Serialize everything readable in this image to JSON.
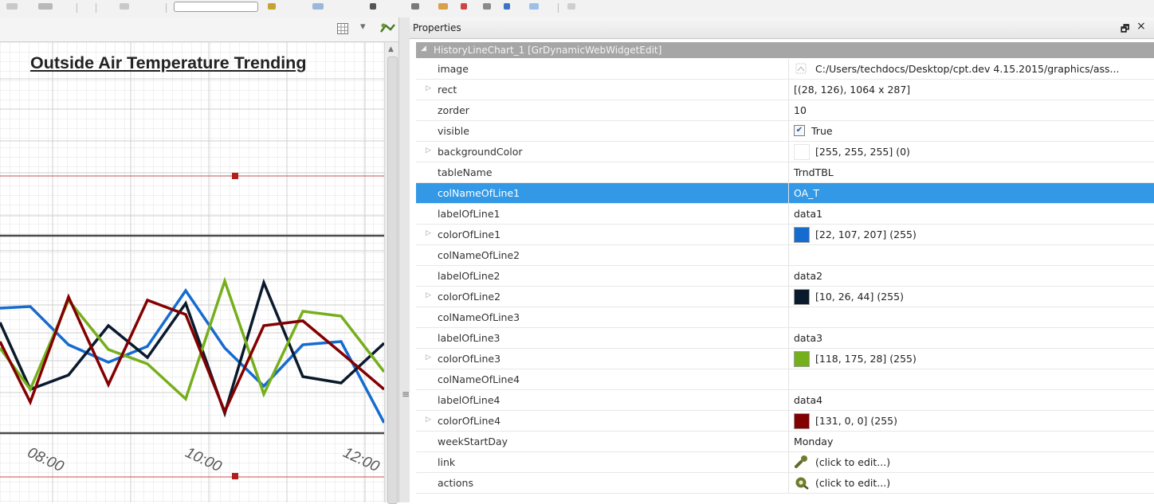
{
  "canvas": {
    "title": "Outside Air Temperature Trending",
    "x_labels": [
      "08:00",
      "10:00",
      "12:00"
    ]
  },
  "properties": {
    "panel_title": "Properties",
    "pin_glyph": "🗗",
    "close_glyph": "×",
    "group_label": "HistoryLineChart_1 [GrDynamicWebWidgetEdit]",
    "rows": [
      {
        "name": "image",
        "value": "C:/Users/techdocs/Desktop/cpt.dev 4.15.2015/graphics/ass...",
        "kind": "icon-image"
      },
      {
        "name": "rect",
        "value": "[(28, 126), 1064 x 287]",
        "expand": true
      },
      {
        "name": "zorder",
        "value": "10"
      },
      {
        "name": "visible",
        "value": "True",
        "kind": "checkbox",
        "checked": true
      },
      {
        "name": "backgroundColor",
        "value": "[255, 255, 255] (0)",
        "expand": true,
        "kind": "swatch",
        "color": "#ffffff"
      },
      {
        "name": "tableName",
        "value": "TrndTBL"
      },
      {
        "name": "colNameOfLine1",
        "value": "OA_T",
        "selected": true
      },
      {
        "name": "labelOfLine1",
        "value": "data1"
      },
      {
        "name": "colorOfLine1",
        "value": "[22, 107, 207] (255)",
        "expand": true,
        "kind": "swatch",
        "color": "#166bcf"
      },
      {
        "name": "colNameOfLine2",
        "value": ""
      },
      {
        "name": "labelOfLine2",
        "value": "data2"
      },
      {
        "name": "colorOfLine2",
        "value": "[10, 26, 44] (255)",
        "expand": true,
        "kind": "swatch",
        "color": "#0a1a2c"
      },
      {
        "name": "colNameOfLine3",
        "value": ""
      },
      {
        "name": "labelOfLine3",
        "value": "data3"
      },
      {
        "name": "colorOfLine3",
        "value": "[118, 175, 28] (255)",
        "expand": true,
        "kind": "swatch",
        "color": "#76af1c"
      },
      {
        "name": "colNameOfLine4",
        "value": ""
      },
      {
        "name": "labelOfLine4",
        "value": "data4"
      },
      {
        "name": "colorOfLine4",
        "value": "[131, 0, 0] (255)",
        "expand": true,
        "kind": "swatch",
        "color": "#830000"
      },
      {
        "name": "weekStartDay",
        "value": "Monday"
      },
      {
        "name": "link",
        "value": "(click to edit...)",
        "kind": "icon-link"
      },
      {
        "name": "actions",
        "value": "(click to edit...)",
        "kind": "icon-actions"
      }
    ]
  },
  "colors": {
    "accent_selection": "#3399e6",
    "line1": "#166bcf",
    "line2": "#0a1a2c",
    "line3": "#76af1c",
    "line4": "#830000",
    "marker": "#b01e1e"
  },
  "icons": [
    "grid-icon",
    "dropdown-arrow-icon",
    "chart-wizard-icon",
    "image-file-icon",
    "link-icon",
    "actions-icon",
    "pin-icon",
    "close-icon",
    "checkbox-icon",
    "expand-arrow-icon",
    "collapse-arrow-icon",
    "splitter-grip-icon"
  ]
}
